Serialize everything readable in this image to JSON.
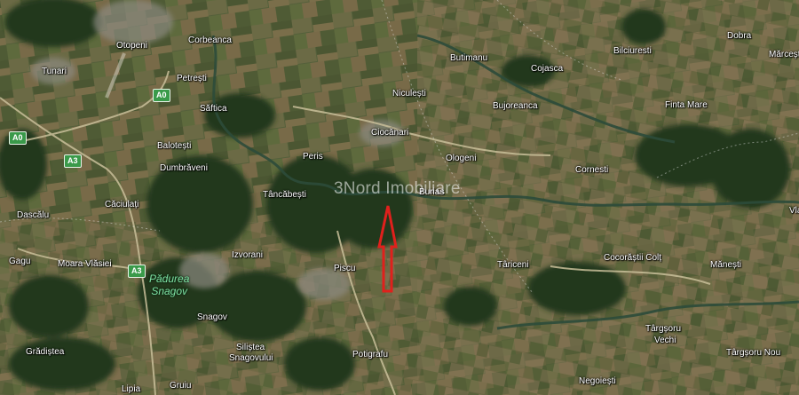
{
  "map": {
    "view": "satellite",
    "colors": {
      "highway_shield": "#3a9a4a",
      "arrow": "#e0201c",
      "forest_label": "#7fe0a3"
    },
    "watermark": "3Nord Imobiliare",
    "forest_label": {
      "line1": "Pădurea",
      "line2": "Snagov"
    },
    "roads": [
      {
        "id": "a0-left",
        "shield": "A0"
      },
      {
        "id": "a0-top",
        "shield": "A0"
      },
      {
        "id": "a3-upper",
        "shield": "A3"
      },
      {
        "id": "a3-lower",
        "shield": "A3"
      }
    ],
    "places": [
      "Otopeni",
      "Corbeanca",
      "Tunari",
      "Petrești",
      "Săftica",
      "Balotești",
      "Dumbrăveni",
      "Peris",
      "Tâncăbești",
      "Căciulați",
      "Dascălu",
      "Gagu",
      "Moara Vlăsiei",
      "Izvorani",
      "Piscu",
      "Snagov",
      "Siliștea",
      "Snagovului",
      "Grădiștea",
      "Potigrafu",
      "Gruiu",
      "Lipia",
      "Butimanu",
      "Niculești",
      "Ciocănari",
      "Cojasca",
      "Bujoreanca",
      "Ologeni",
      "Burias",
      "Bilciuresti",
      "Dobra",
      "Mărcești",
      "Finta Mare",
      "Cornesti",
      "Vla",
      "Târiceni",
      "Cocorăștii Colț",
      "Mănești",
      "Târgșoru",
      "Vechi",
      "Târgșoru Nou",
      "Negoiești"
    ],
    "marker": {
      "type": "red-outline-arrow",
      "direction": "up"
    }
  }
}
